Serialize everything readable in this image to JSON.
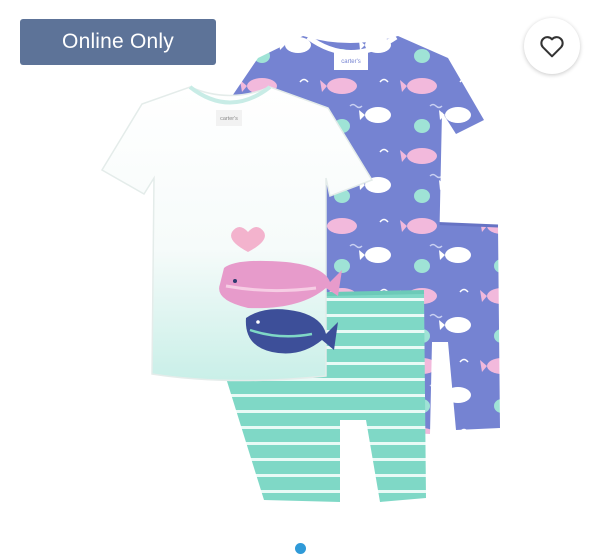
{
  "badge": {
    "label": "Online Only"
  },
  "favorite": {
    "icon": "heart-outline-icon"
  },
  "gallery": {
    "product": "four-piece-whale-pajama-set",
    "slide_count": 1,
    "active_slide": 1,
    "dot_color": "#2f9ad8"
  },
  "tag_text": "carter's 3T",
  "colors": {
    "badge_bg": "#5d7398",
    "purple_set": "#7583d2",
    "mint_shorts": "#7fd8c6",
    "pink_whale": "#e79bcb"
  }
}
